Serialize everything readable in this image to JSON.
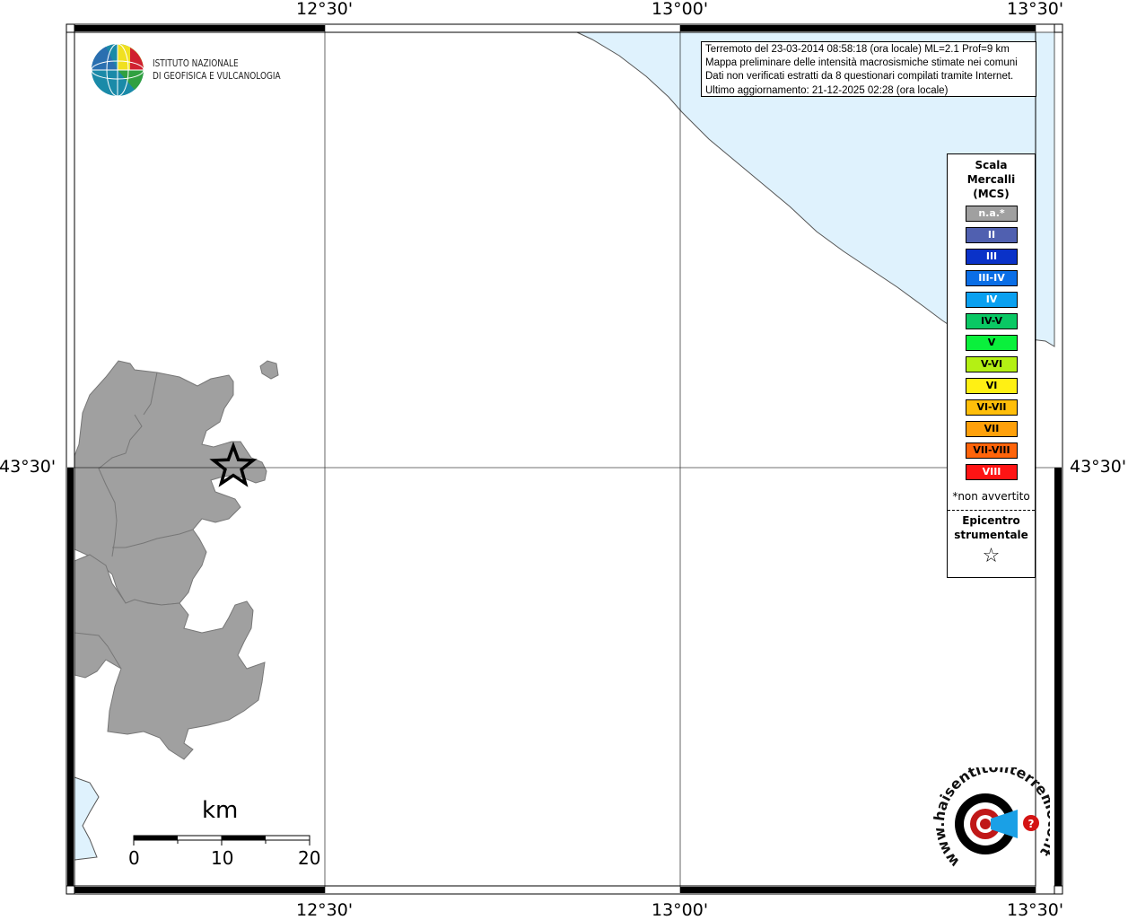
{
  "map": {
    "lon_ticks": [
      "12°30'",
      "13°00'",
      "13°30'"
    ],
    "lat_tick": "43°30'"
  },
  "info_box": {
    "line1": "Terremoto del 23-03-2014 08:58:18 (ora locale) ML=2.1 Prof=9 km",
    "line2": "Mappa preliminare delle intensità macrosismiche stimate nei comuni",
    "line3": "Dati non verificati estratti da 8 questionari compilati tramite Internet.",
    "line4": "Ultimo aggiornamento: 21-12-2025 02:28 (ora locale)"
  },
  "logo": {
    "line1": "ISTITUTO NAZIONALE",
    "line2": "DI GEOFISICA E VULCANOLOGIA"
  },
  "legend": {
    "title_line1": "Scala",
    "title_line2": "Mercalli",
    "title_line3": "(MCS)",
    "items": [
      {
        "label": "n.a.*",
        "color": "#a0a0a0",
        "text_color": "#ffffff"
      },
      {
        "label": "II",
        "color": "#5060b0",
        "text_color": "#ffffff"
      },
      {
        "label": "III",
        "color": "#0a32c8",
        "text_color": "#ffffff"
      },
      {
        "label": "III-IV",
        "color": "#0a6ee6",
        "text_color": "#ffffff"
      },
      {
        "label": "IV",
        "color": "#0aa0f0",
        "text_color": "#ffffff"
      },
      {
        "label": "IV-V",
        "color": "#0ac864",
        "text_color": "#000000"
      },
      {
        "label": "V",
        "color": "#0af03c",
        "text_color": "#000000"
      },
      {
        "label": "V-VI",
        "color": "#b4f014",
        "text_color": "#000000"
      },
      {
        "label": "VI",
        "color": "#fff014",
        "text_color": "#000000"
      },
      {
        "label": "VI-VII",
        "color": "#ffbe0a",
        "text_color": "#000000"
      },
      {
        "label": "VII",
        "color": "#ffa00a",
        "text_color": "#000000"
      },
      {
        "label": "VII-VIII",
        "color": "#ff640a",
        "text_color": "#000000"
      },
      {
        "label": "VIII",
        "color": "#ff1414",
        "text_color": "#ffffff"
      }
    ],
    "note": "*non avvertito",
    "epi_line1": "Epicentro",
    "epi_line2": "strumentale",
    "epi_symbol": "☆"
  },
  "scale_bar": {
    "title": "km",
    "labels": [
      "0",
      "10",
      "20"
    ]
  },
  "colors": {
    "sea": "#dff2fd",
    "land": "#a0a0a0"
  },
  "hsr_logo": {
    "text": "www.haisentitoilterremoto.it"
  }
}
